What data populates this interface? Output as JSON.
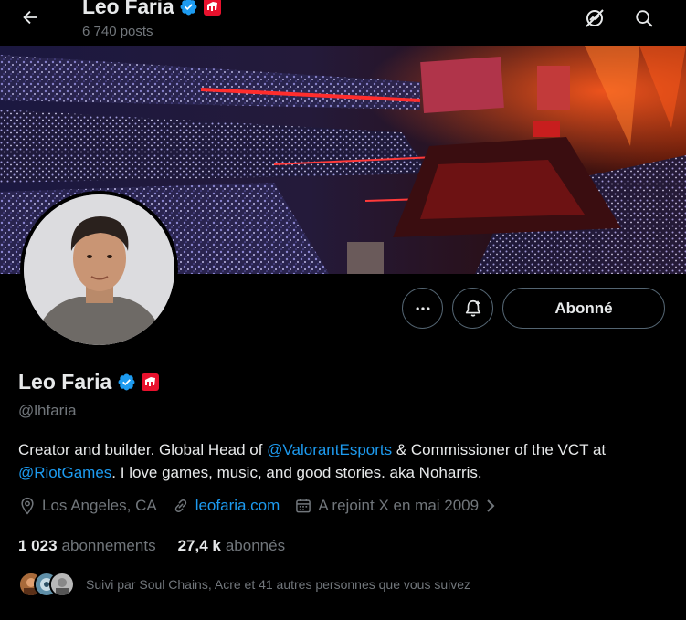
{
  "header": {
    "name": "Leo Faria",
    "posts_count": "6 740 posts",
    "icons": [
      "back-arrow-icon",
      "no-signal-icon",
      "search-icon"
    ]
  },
  "profile": {
    "name": "Leo Faria",
    "handle": "@lhfaria",
    "bio": {
      "part1": "Creator and builder. Global Head of ",
      "mention1": "@ValorantEsports",
      "part2": " & Commissioner of the VCT at ",
      "mention2": "@RiotGames",
      "part3": ". I love games, music, and good stories. aka Noharris."
    },
    "location": "Los Angeles, CA",
    "website": "leofaria.com",
    "joined": "A rejoint X en mai 2009",
    "following_count": "1 023",
    "following_label": "abonnements",
    "followers_count": "27,4 k",
    "followers_label": "abonnés",
    "followed_by": "Suivi par Soul Chains, Acre et 41 autres personnes que vous suivez"
  },
  "actions": {
    "follow_label": "Abonné",
    "icons": [
      "more-icon",
      "notification-bell-icon"
    ]
  },
  "colors": {
    "background": "#000000",
    "text": "#e7e9ea",
    "muted": "#71767b",
    "accent": "#1d9bf0",
    "verified": "#1d9bf0",
    "org_badge": "#e8112d",
    "border": "#536471"
  }
}
